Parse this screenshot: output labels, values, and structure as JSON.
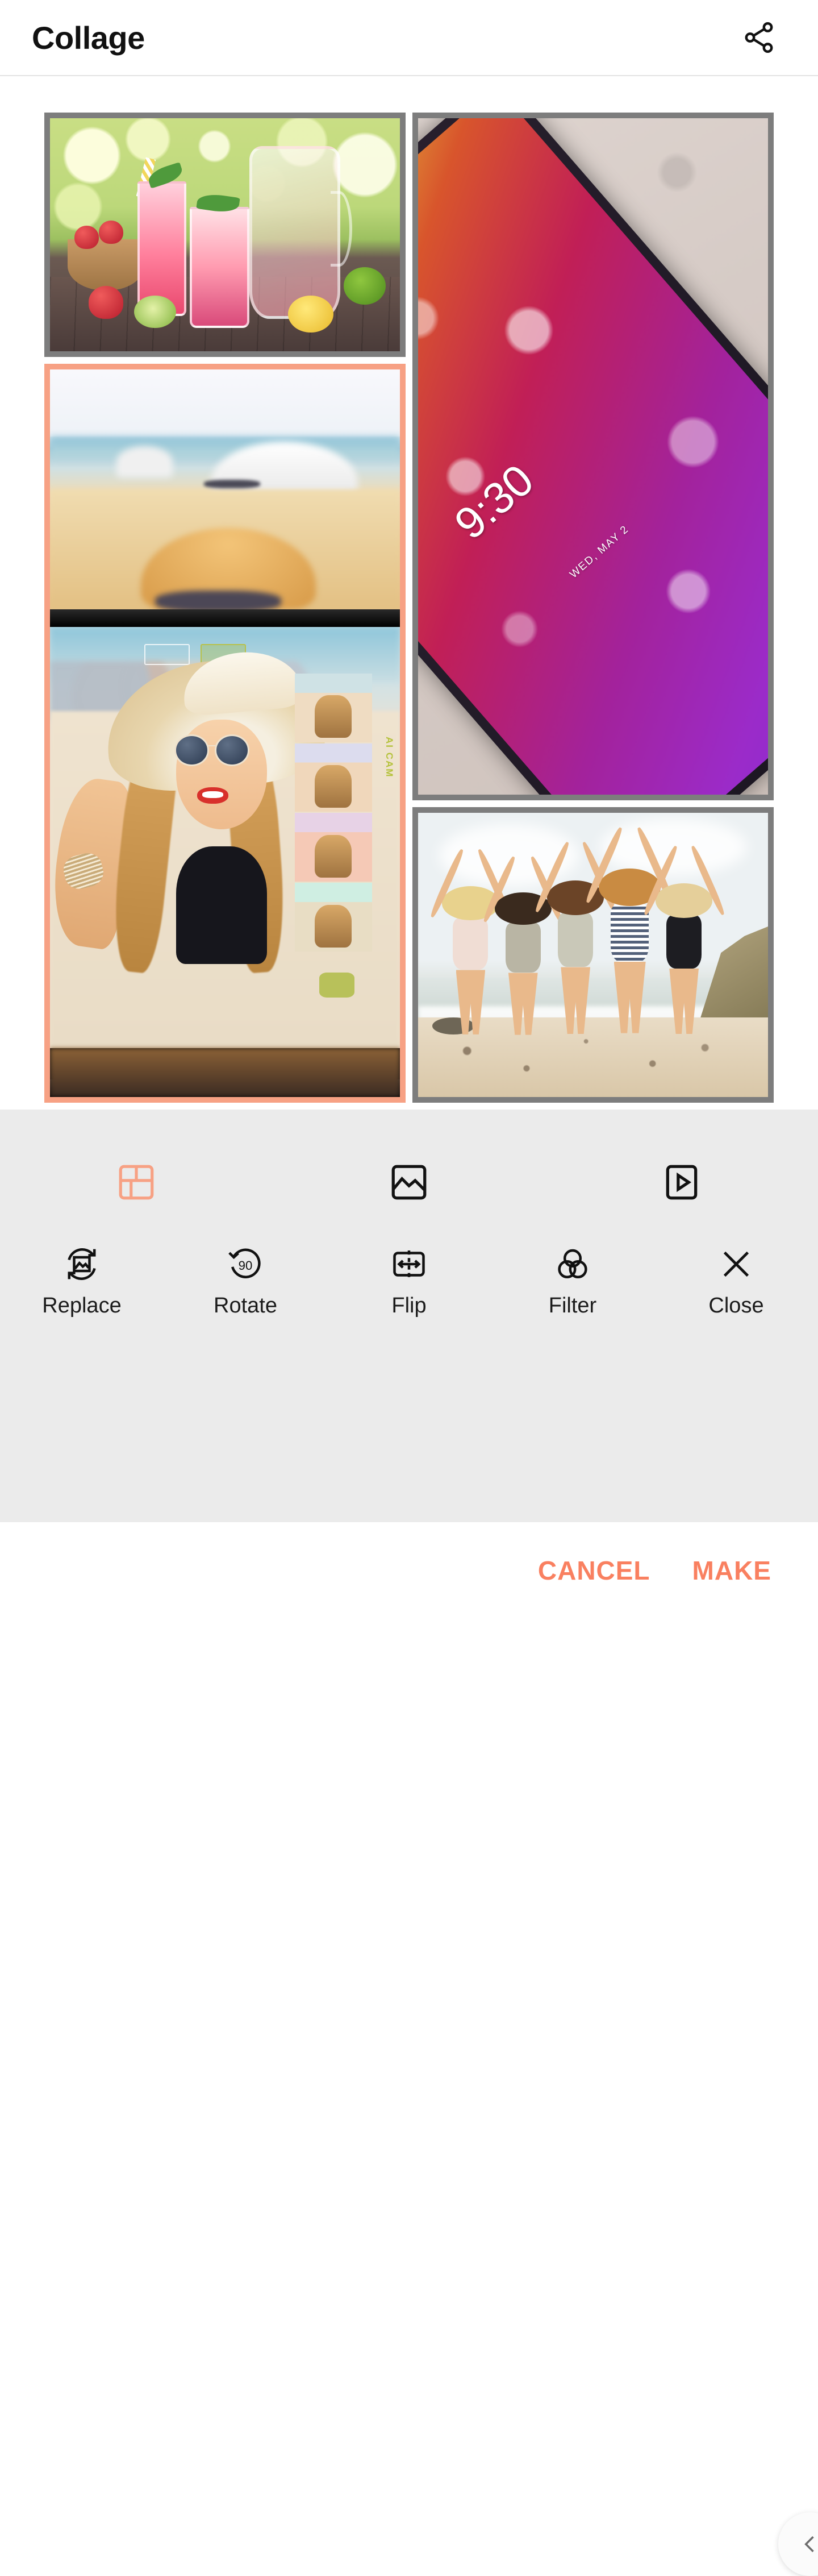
{
  "header": {
    "title": "Collage",
    "share_icon": "share-icon"
  },
  "collage": {
    "selected_index": 1,
    "border_color_default": "#7d7d7d",
    "border_color_selected": "#f7a184",
    "cells": [
      {
        "name": "fruit-lemonade-photo",
        "description": "Two glasses of strawberry lemonade with mint and a glass pitcher on a wooden table, bowl of strawberries, lemon and lime halves, green bokeh background",
        "position": "top-left",
        "selected": false
      },
      {
        "name": "beach-selfie-phone-photo",
        "description": "Blurred beach with sun hat above; phone screen showing AI CAM selfie of a blonde woman in a straw sun hat and round sunglasses with red lipstick, filter thumbnails on the right",
        "position": "left-tall",
        "selected": true,
        "overlay_text": "AI CAM"
      },
      {
        "name": "wet-phone-wallpaper-photo",
        "description": "Smartphone with water droplets on its screen lying on concrete, lock screen gradient wallpaper in yellow, red, pink and purple",
        "position": "right-tall",
        "selected": false,
        "overlay_time": "9:30",
        "overlay_date": "WED, MAY 2"
      },
      {
        "name": "friends-jumping-beach-photo",
        "description": "Five friends jumping in the air on a sandy beach with ocean and a rocky headland behind",
        "position": "bottom-right",
        "selected": false
      }
    ]
  },
  "panel": {
    "tabs": [
      {
        "id": "layout",
        "icon": "grid-layout-icon",
        "active": true
      },
      {
        "id": "background",
        "icon": "image-icon",
        "active": false
      },
      {
        "id": "slideshow",
        "icon": "play-icon",
        "active": false
      }
    ],
    "tools": [
      {
        "label": "Replace",
        "icon": "replace-image-icon"
      },
      {
        "label": "Rotate",
        "icon": "rotate-90-icon",
        "badge": "90"
      },
      {
        "label": "Flip",
        "icon": "flip-horizontal-icon"
      },
      {
        "label": "Filter",
        "icon": "filter-circles-icon"
      },
      {
        "label": "Close",
        "icon": "close-x-icon"
      }
    ],
    "handle_icon": "chevron-left-icon"
  },
  "actions": {
    "cancel_label": "CANCEL",
    "make_label": "MAKE",
    "accent_color": "#f98060"
  }
}
